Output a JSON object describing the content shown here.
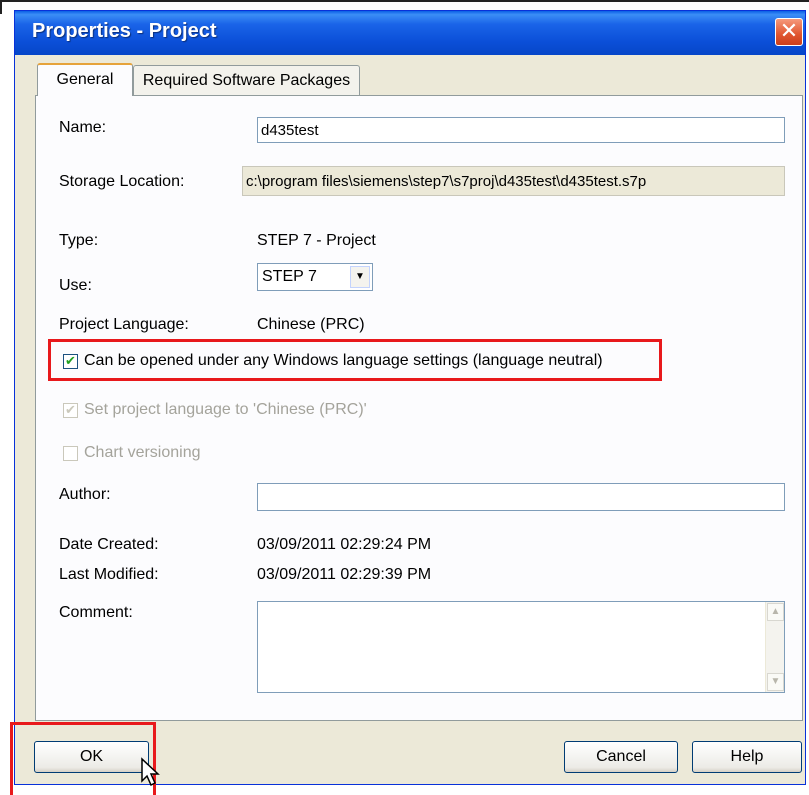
{
  "window": {
    "title": "Properties - Project",
    "close_glyph": "✕"
  },
  "tabs": [
    {
      "label": "General",
      "active": true
    },
    {
      "label": "Required Software Packages",
      "active": false
    }
  ],
  "general": {
    "name_label": "Name:",
    "name_value": "d435test",
    "storage_label": "Storage Location:",
    "storage_value": "c:\\program files\\siemens\\step7\\s7proj\\d435test\\d435test.s7p",
    "type_label": "Type:",
    "type_value": "STEP 7 - Project",
    "use_label": "Use:",
    "use_value": "STEP 7",
    "lang_label": "Project Language:",
    "lang_value": "Chinese (PRC)",
    "cb_neutral_label": "Can be opened under any Windows language settings (language neutral)",
    "cb_neutral_checked": true,
    "cb_setlang_label": "Set project language to 'Chinese (PRC)'",
    "cb_setlang_checked": true,
    "cb_versioning_label": "Chart versioning",
    "cb_versioning_checked": false,
    "author_label": "Author:",
    "author_value": "",
    "created_label": "Date Created:",
    "created_value": "03/09/2011 02:29:24 PM",
    "modified_label": "Last Modified:",
    "modified_value": "03/09/2011 02:29:39 PM",
    "comment_label": "Comment:",
    "comment_value": ""
  },
  "buttons": {
    "ok": "OK",
    "cancel": "Cancel",
    "help": "Help"
  },
  "colors": {
    "highlight": "#e8191c",
    "titlebar": "#0b4fd8",
    "dialog_bg": "#ece9d8"
  }
}
